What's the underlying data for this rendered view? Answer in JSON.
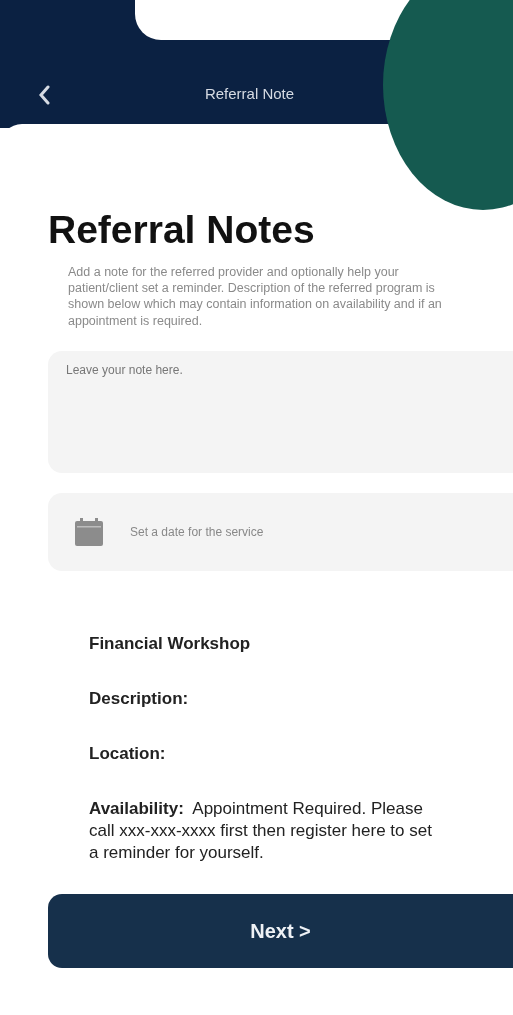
{
  "header": {
    "title": "Referral Note"
  },
  "heading": "Referral Notes",
  "intro": "Add a note for the referred provider and optionally help your patient/client set a reminder.  Description of the referred program is shown below which may contain information on availability and if an appointment is required.",
  "note_field": {
    "placeholder": "Leave your note here."
  },
  "date_field": {
    "placeholder": "Set a date for the service"
  },
  "program": {
    "title": "Financial Workshop",
    "details": [
      {
        "label": "Description:"
      },
      {
        "label": "Location:"
      },
      {
        "label": "Availability:",
        "value": "Appointment Required. Please call xxx-xxx-xxxx first then register here to set a reminder for yourself."
      }
    ]
  },
  "buttons": [
    {
      "label": "Next >"
    }
  ]
}
